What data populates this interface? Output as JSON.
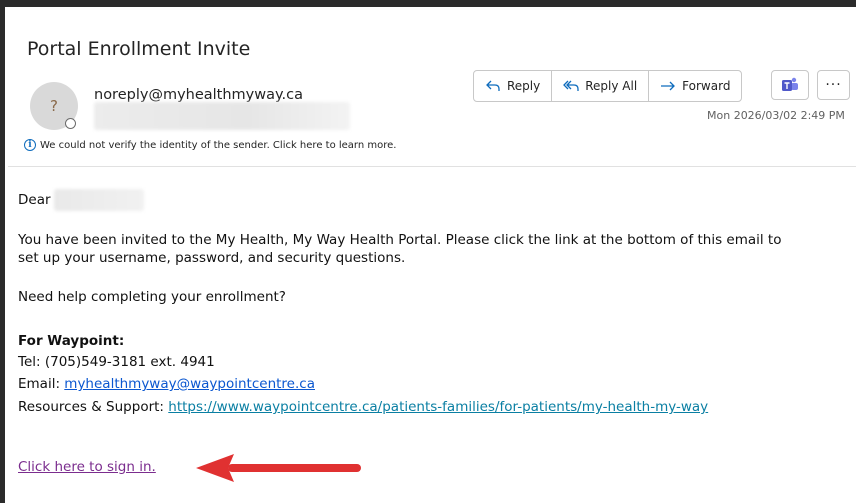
{
  "email": {
    "subject": "Portal Enrollment Invite",
    "avatar_initial": "?",
    "sender": "noreply@myhealthmyway.ca",
    "verify_notice": "We could not verify the identity of the sender. Click here to learn more.",
    "timestamp": "Mon 2026/03/02 2:49 PM"
  },
  "actions": {
    "reply": "Reply",
    "reply_all": "Reply All",
    "forward": "Forward",
    "more": "···"
  },
  "body": {
    "greeting": "Dear",
    "para1_line1": "You have been invited to the My Health, My Way Health Portal. Please click the link at the bottom of this email to",
    "para1_line2": "set up your username, password, and security questions.",
    "help": "Need help completing your enrollment?",
    "org_label": "For Waypoint:",
    "tel": "Tel: (705)549-3181 ext. 4941",
    "email_label": "Email: ",
    "email_link": "myhealthmyway@waypointcentre.ca",
    "resources_label": "Resources & Support: ",
    "resources_link": "https://www.waypointcentre.ca/patients-families/for-patients/my-health-my-way",
    "signin_link": "Click here to sign in."
  },
  "colors": {
    "accent": "#0f6cbd",
    "arrow": "#e03131",
    "visited_link": "#7b2d8e"
  }
}
